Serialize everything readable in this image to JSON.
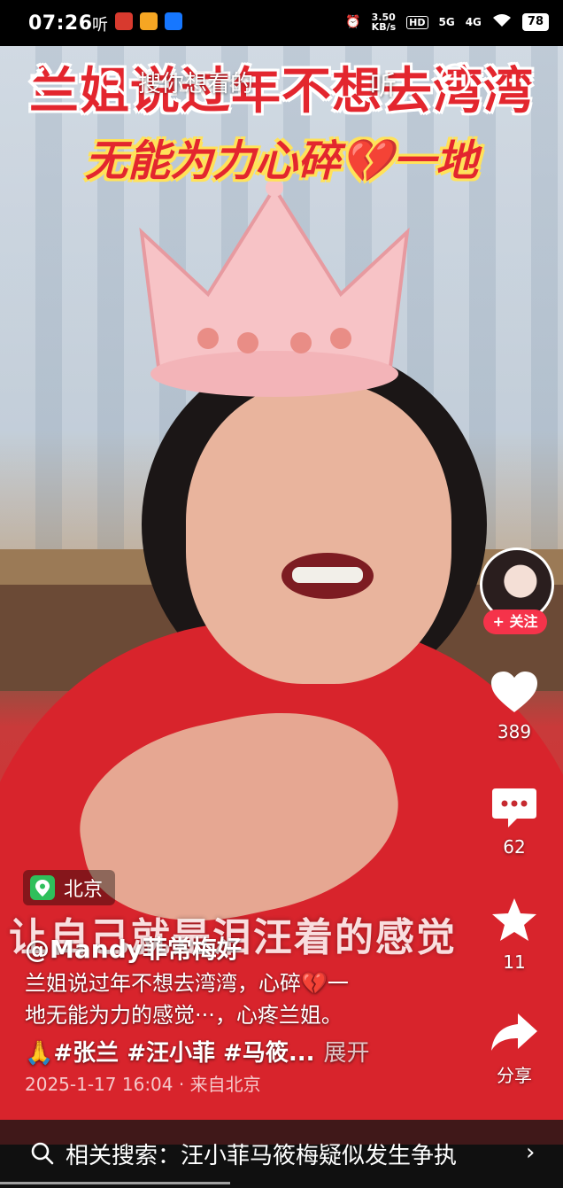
{
  "status_bar": {
    "time": "07:26",
    "listen_glyph": "听",
    "net_speed": "3.50\nKB/s",
    "hd": "HD",
    "signal1": "5G",
    "signal2": "4G",
    "battery": "78"
  },
  "top_nav": {
    "search_placeholder": "搜你想看的",
    "listen_label": "听"
  },
  "captions": {
    "line1": "兰姐说过年不想去湾湾",
    "line2_a": "无能为力心碎",
    "line2_b": "一地",
    "video_subtitle": "让自己就是泪汪着的感觉"
  },
  "right_rail": {
    "follow_label": "+ 关注",
    "likes": "389",
    "comments": "62",
    "favorites": "11",
    "share_label": "分享"
  },
  "post": {
    "location": "北京",
    "author": "@Mandy菲常梅好",
    "description_line1": "兰姐说过年不想去湾湾，心碎💔一",
    "description_line2": "地无能为力的感觉···，心疼兰姐。",
    "tags": "🙏#张兰 #汪小菲 #马筱...",
    "expand_label": "展开",
    "meta": "2025-1-17 16:04 · 来自北京"
  },
  "related_search": {
    "text": "相关搜索：汪小菲马筱梅疑似发生争执"
  },
  "colors": {
    "accent_red": "#e3262e",
    "follow_red": "#f5334a"
  }
}
